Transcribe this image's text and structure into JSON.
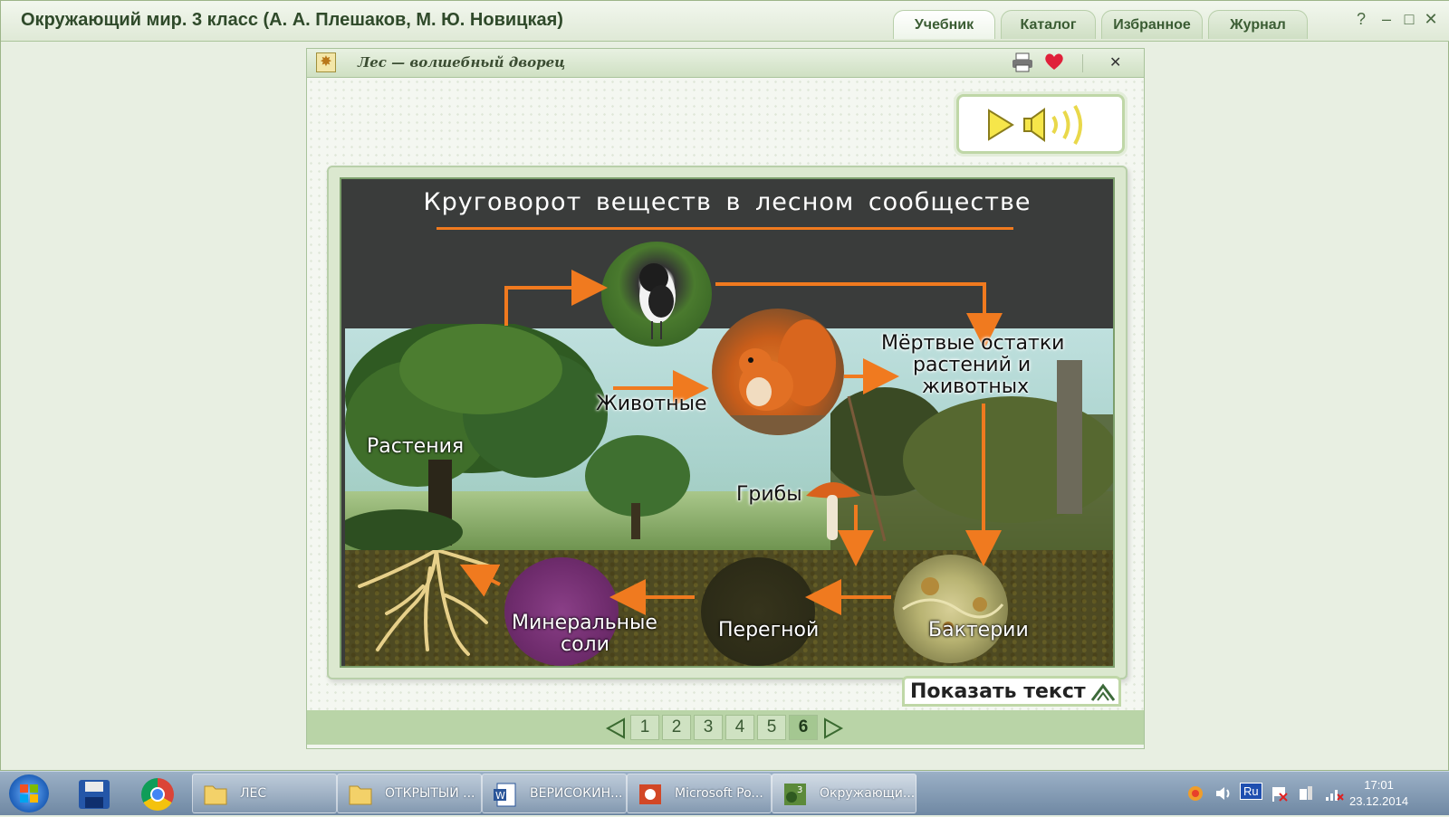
{
  "app": {
    "title": "Окружающий мир. 3 класс (А. А. Плешаков, М. Ю. Новицкая)",
    "tabs": [
      {
        "label": "Учебник",
        "active": true
      },
      {
        "label": "Каталог",
        "active": false
      },
      {
        "label": "Избранное",
        "active": false
      },
      {
        "label": "Журнал",
        "active": false
      }
    ],
    "window_controls": {
      "help": "?",
      "minimize": "–",
      "maximize": "□",
      "close": "✕"
    }
  },
  "document": {
    "title": "Лес — волшебный дворец",
    "close": "✕",
    "icons": [
      "printer-icon",
      "heart-icon"
    ]
  },
  "slide": {
    "title": "Круговорот веществ в лесном сообществе",
    "labels": {
      "plants": "Растения",
      "animals": "Животные",
      "dead_remains_1": "Мёртвые остатки",
      "dead_remains_2": "растений и",
      "dead_remains_3": "животных",
      "fungi": "Грибы",
      "bacteria": "Бактерии",
      "humus": "Перегной",
      "mineral_1": "Минеральные",
      "mineral_2": "соли"
    },
    "colors": {
      "arrow": "#f07a1f",
      "background": "#3a3c3b"
    }
  },
  "controls": {
    "show_text": "Показать текст",
    "pages": [
      "1",
      "2",
      "3",
      "4",
      "5",
      "6"
    ],
    "current_page": "6"
  },
  "taskbar": {
    "buttons": [
      {
        "label": "ЛЕС"
      },
      {
        "label": "ОТКРЫТЫЙ ..."
      },
      {
        "label": "ВЕРИСОКИН..."
      },
      {
        "label": "Microsoft Po..."
      },
      {
        "label": "Окружающи..."
      }
    ],
    "tray": {
      "language": "Ru"
    },
    "clock": {
      "time": "17:01",
      "date": "23.12.2014"
    }
  }
}
